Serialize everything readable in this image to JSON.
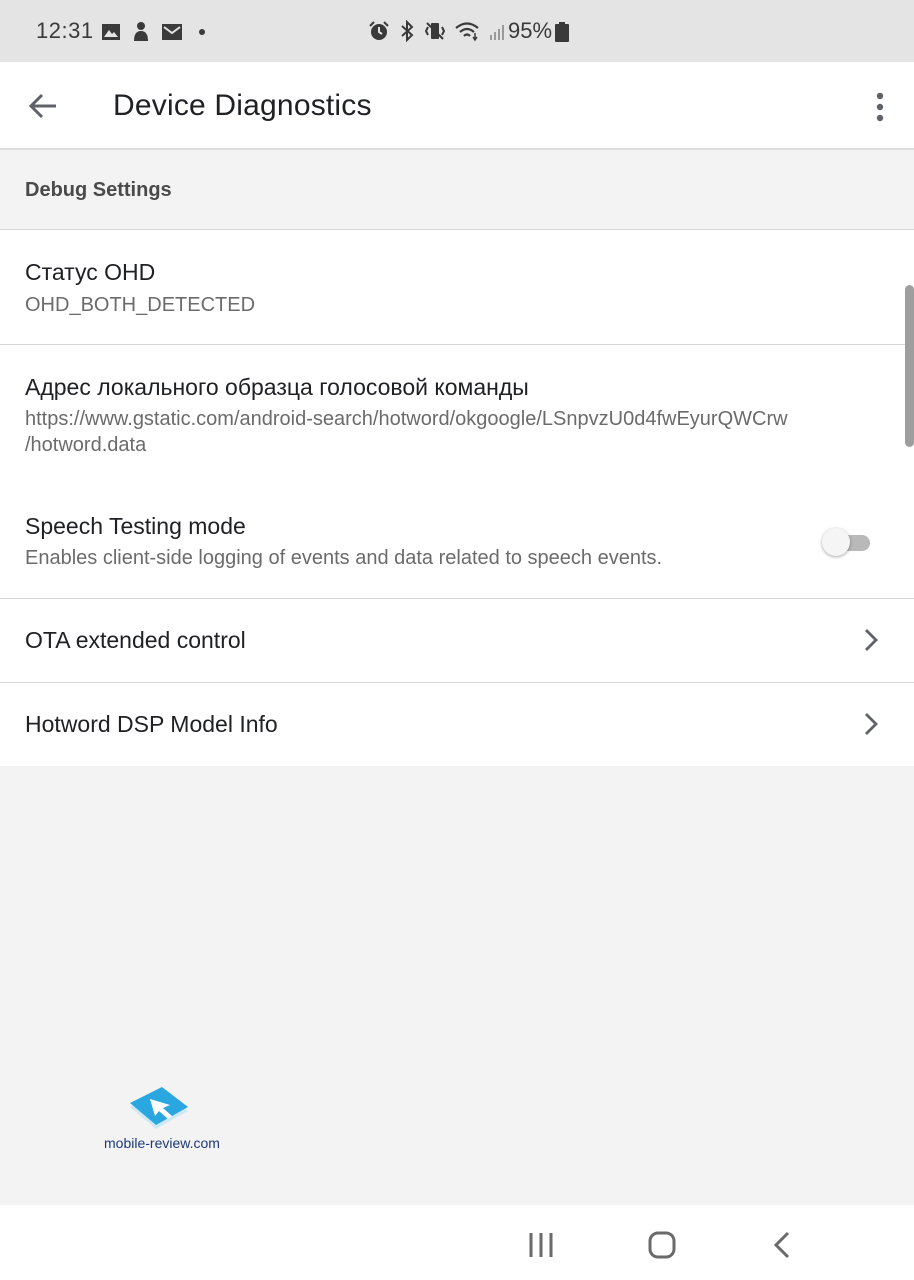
{
  "status_bar": {
    "time": "12:31",
    "left_icons": [
      "image-icon",
      "hand-icon",
      "mail-icon",
      "dot-icon"
    ],
    "right_icons": [
      "alarm-icon",
      "bluetooth-icon",
      "vibrate-icon",
      "wifi-icon",
      "signal-icon"
    ],
    "battery_text": "95%"
  },
  "app_bar": {
    "title": "Device Diagnostics",
    "back_icon": "arrow-back-icon",
    "more_icon": "more-vert-icon"
  },
  "section": {
    "title": "Debug Settings"
  },
  "items": [
    {
      "title": "Статус OHD",
      "subtitle": "OHD_BOTH_DETECTED"
    },
    {
      "title": "Адрес локального образца голосовой команды",
      "subtitle_line1": "https://www.gstatic.com/android-search/hotword/okgoogle/LSnpvzU0d4fwEyurQWCrw",
      "subtitle_line2": "/hotword.data"
    },
    {
      "title": "Speech Testing mode",
      "subtitle": "Enables client-side logging of events and data related to speech events.",
      "toggle_on": false
    },
    {
      "title": "OTA extended control",
      "chevron": "chevron-right-icon"
    },
    {
      "title": "Hotword DSP Model Info",
      "chevron": "chevron-right-icon"
    }
  ],
  "watermark": {
    "text": "mobile-review.com"
  },
  "nav_bar": {
    "buttons": [
      "recents-icon",
      "home-icon",
      "back-icon"
    ]
  },
  "colors": {
    "status_bar_bg": "#e4e4e4",
    "app_bar_bg": "#ffffff",
    "page_bg": "#f3f3f3",
    "text_primary": "#202124",
    "text_secondary": "#6b6b6b",
    "divider": "#d6d6d6",
    "watermark_blue": "#2aa7e0"
  }
}
